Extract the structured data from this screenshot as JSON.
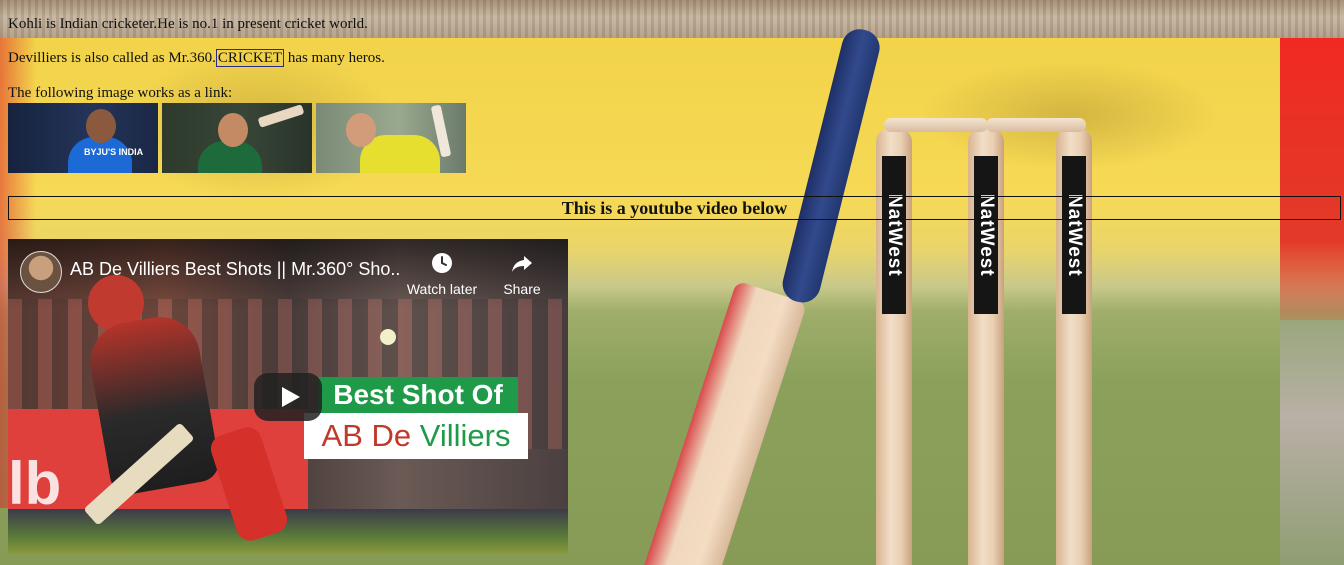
{
  "intro": {
    "line1": "Kohli is Indian cricketer.He is no.1 in present cricket world.",
    "line2_before": "Devilliers is also called as Mr.360.",
    "line2_link": "CRICKET",
    "line2_after": " has many heros.",
    "line3": "The following image works as a link:"
  },
  "thumbnails": [
    {
      "name": "kohli",
      "tag": "BYJU'S INDIA"
    },
    {
      "name": "devilliers"
    },
    {
      "name": "warner"
    }
  ],
  "heading": "This is a youtube video below",
  "video": {
    "title": "AB De Villiers Best Shots || Mr.360° Sho...",
    "watch_later": "Watch later",
    "share": "Share",
    "banner_line1": "Best Shot Of",
    "banner_line2_a": "AB De ",
    "banner_line2_b": "Villiers",
    "board_text": "lb"
  },
  "background": {
    "stump_brand": "NatWest"
  },
  "colors": {
    "banner_green": "#1e9a48",
    "banner_red": "#c0392b",
    "background_yellow": "#f2d34a"
  }
}
